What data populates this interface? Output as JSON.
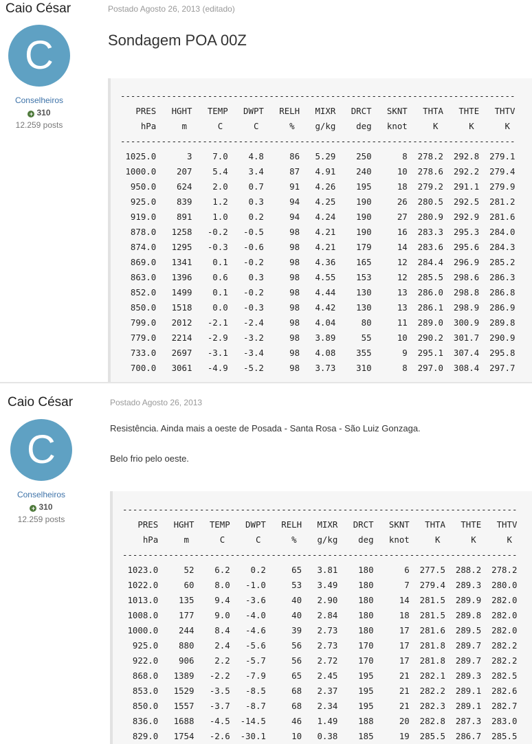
{
  "posts": [
    {
      "author": "Caio César",
      "avatar_letter": "C",
      "group": "Conselheiros",
      "reputation": "310",
      "posts_count": "12.259 posts",
      "meta": "Postado Agosto 26, 2013 (editado)",
      "title": "Sondagem POA 00Z",
      "code": "-----------------------------------------------------------------------------\n   PRES   HGHT   TEMP   DWPT   RELH   MIXR   DRCT   SKNT   THTA   THTE   THTV\n    hPa     m      C      C      %    g/kg    deg   knot     K      K      K \n-----------------------------------------------------------------------------\n 1025.0      3    7.0    4.8     86   5.29    250      8  278.2  292.8  279.1\n 1000.0    207    5.4    3.4     87   4.91    240     10  278.6  292.2  279.4\n  950.0    624    2.0    0.7     91   4.26    195     18  279.2  291.1  279.9\n  925.0    839    1.2    0.3     94   4.25    190     26  280.5  292.5  281.2\n  919.0    891    1.0    0.2     94   4.24    190     27  280.9  292.9  281.6\n  878.0   1258   -0.2   -0.5     98   4.21    190     16  283.3  295.3  284.0\n  874.0   1295   -0.3   -0.6     98   4.21    179     14  283.6  295.6  284.3\n  869.0   1341    0.1   -0.2     98   4.36    165     12  284.4  296.9  285.2\n  863.0   1396    0.6    0.3     98   4.55    153     12  285.5  298.6  286.3\n  852.0   1499    0.1   -0.2     98   4.44    130     13  286.0  298.8  286.8\n  850.0   1518    0.0   -0.3     98   4.42    130     13  286.1  298.9  286.9\n  799.0   2012   -2.1   -2.4     98   4.04     80     11  289.0  300.9  289.8\n  779.0   2214   -2.9   -3.2     98   3.89     55     10  290.2  301.7  290.9\n  733.0   2697   -3.1   -3.4     98   4.08    355      9  295.1  307.4  295.8\n  700.0   3061   -4.9   -5.2     98   3.73    310      8  297.0  308.4  297.7"
    },
    {
      "author": "Caio César",
      "avatar_letter": "C",
      "group": "Conselheiros",
      "reputation": "310",
      "posts_count": "12.259 posts",
      "meta": "Postado Agosto 26, 2013",
      "text1": "Resistência. Ainda mais a oeste de Posada - Santa Rosa - São Luiz Gonzaga.",
      "text2": "Belo frio pelo oeste.",
      "code": "-----------------------------------------------------------------------------\n   PRES   HGHT   TEMP   DWPT   RELH   MIXR   DRCT   SKNT   THTA   THTE   THTV\n    hPa     m      C      C      %    g/kg    deg   knot     K      K      K \n-----------------------------------------------------------------------------\n 1023.0     52    6.2    0.2     65   3.81    180      6  277.5  288.2  278.2\n 1022.0     60    8.0   -1.0     53   3.49    180      7  279.4  289.3  280.0\n 1013.0    135    9.4   -3.6     40   2.90    180     14  281.5  289.9  282.0\n 1008.0    177    9.0   -4.0     40   2.84    180     18  281.5  289.8  282.0\n 1000.0    244    8.4   -4.6     39   2.73    180     17  281.6  289.5  282.0\n  925.0    880    2.4   -5.6     56   2.73    170     17  281.8  289.7  282.2\n  922.0    906    2.2   -5.7     56   2.72    170     17  281.8  289.7  282.2\n  868.0   1389   -2.2   -7.9     65   2.45    195     21  282.1  289.3  282.5\n  853.0   1529   -3.5   -8.5     68   2.37    195     21  282.2  289.1  282.6\n  850.0   1557   -3.7   -8.7     68   2.34    195     21  282.3  289.1  282.7\n  836.0   1688   -4.5  -14.5     46   1.49    188     20  282.8  287.3  283.0\n  829.0   1754   -2.6  -30.1     10   0.38    185     19  285.5  286.7  285.5"
    }
  ]
}
